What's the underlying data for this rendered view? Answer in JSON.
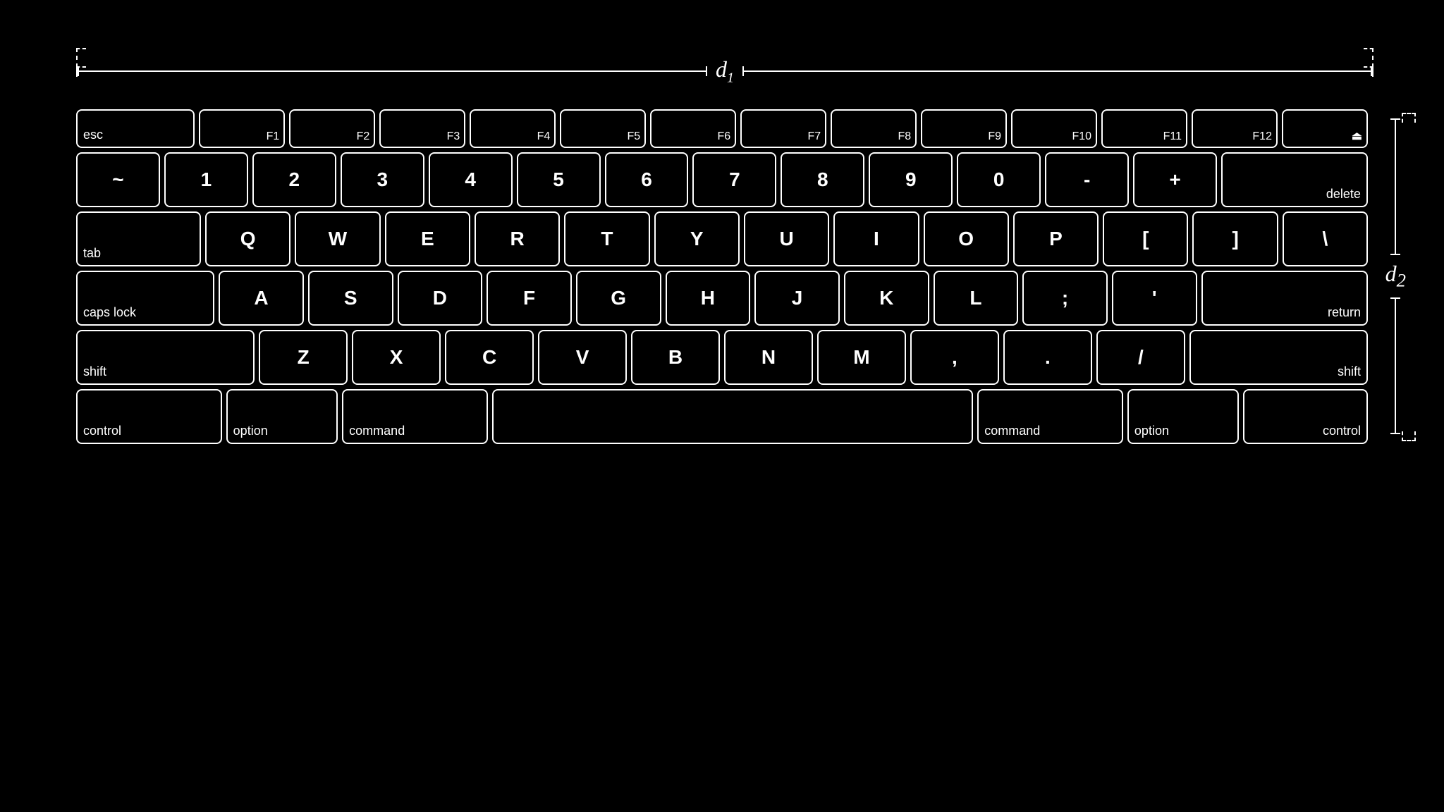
{
  "dimensions": {
    "d1_label": "d",
    "d1_sub": "1",
    "d2_label": "d",
    "d2_sub": "2"
  },
  "keyboard": {
    "rows": {
      "fn": [
        "esc",
        "F1",
        "F2",
        "F3",
        "F4",
        "F5",
        "F6",
        "F7",
        "F8",
        "F9",
        "F10",
        "F11",
        "F12",
        "⏏"
      ],
      "num": [
        "~",
        "1",
        "2",
        "3",
        "4",
        "5",
        "6",
        "7",
        "8",
        "9",
        "0",
        "-",
        "+",
        "delete"
      ],
      "qwerty": [
        "tab",
        "Q",
        "W",
        "E",
        "R",
        "T",
        "Y",
        "U",
        "I",
        "O",
        "P",
        "[",
        "]",
        "\\"
      ],
      "asdf": [
        "caps lock",
        "A",
        "S",
        "D",
        "F",
        "G",
        "H",
        "J",
        "K",
        "L",
        ";",
        "'",
        "return"
      ],
      "zxcv": [
        "shift",
        "Z",
        "X",
        "C",
        "V",
        "B",
        "N",
        "M",
        ",",
        ".",
        "/",
        "shift"
      ],
      "bottom": [
        "control",
        "option",
        "command",
        "",
        "command",
        "option",
        "control"
      ]
    }
  }
}
